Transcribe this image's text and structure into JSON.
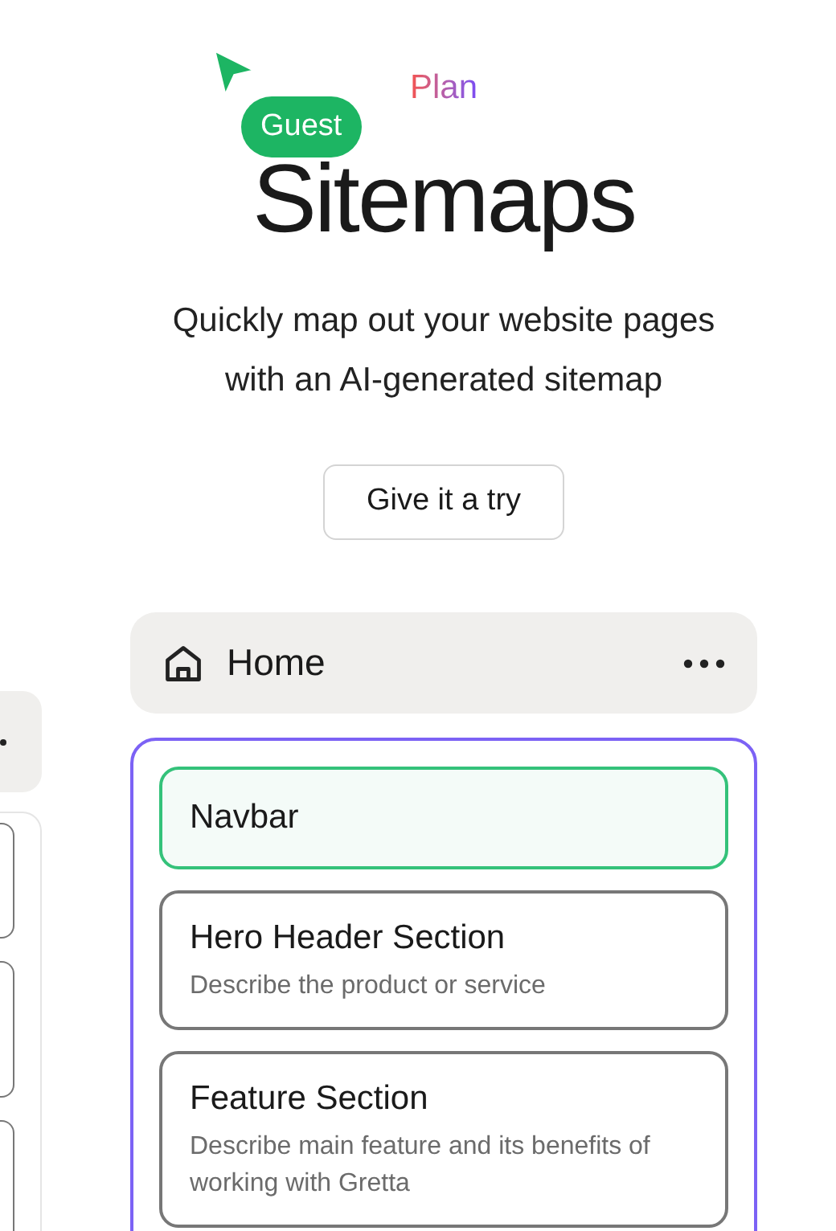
{
  "eyebrow": "Plan",
  "cursor": {
    "label": "Guest"
  },
  "title": "Sitemaps",
  "subtitle": "Quickly map out your website pages with an AI-generated sitemap",
  "cta": "Give it a try",
  "page": {
    "title": "Home",
    "sections": [
      {
        "title": "Navbar",
        "selected": true
      },
      {
        "title": "Hero Header Section",
        "description": "Describe the product or service",
        "selected": false
      },
      {
        "title": "Feature Section",
        "description": "Describe main feature and its benefits of working with Gretta",
        "selected": false
      }
    ]
  }
}
